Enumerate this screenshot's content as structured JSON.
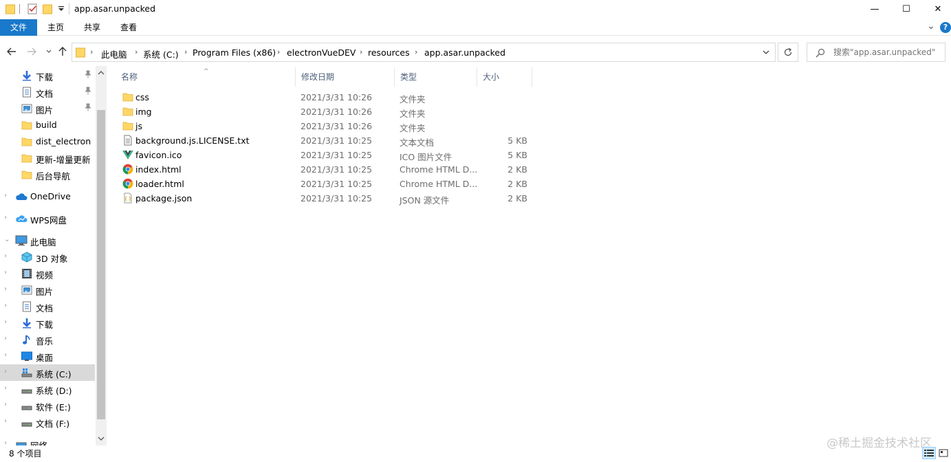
{
  "window": {
    "title": "app.asar.unpacked",
    "minimize": "—",
    "maximize": "☐",
    "close": "✕"
  },
  "ribbon": {
    "tabs": [
      "文件",
      "主页",
      "共享",
      "查看"
    ],
    "expand": "⌄",
    "help": "?"
  },
  "address": {
    "crumbs": [
      "此电脑",
      "系统 (C:)",
      "Program Files (x86)",
      "electronVueDEV",
      "resources",
      "app.asar.unpacked"
    ]
  },
  "search": {
    "placeholder": "搜索\"app.asar.unpacked\""
  },
  "nav": {
    "quick_access": [
      {
        "label": "下载",
        "icon": "download-arrow-icon",
        "pinned": true
      },
      {
        "label": "文档",
        "icon": "document-icon",
        "pinned": true
      },
      {
        "label": "图片",
        "icon": "pictures-icon",
        "pinned": true
      },
      {
        "label": "build",
        "icon": "folder-icon",
        "pinned": false
      },
      {
        "label": "dist_electron",
        "icon": "folder-icon",
        "pinned": false
      },
      {
        "label": "更新-增量更新",
        "icon": "folder-icon",
        "pinned": false
      },
      {
        "label": "后台导航",
        "icon": "folder-icon",
        "pinned": false
      }
    ],
    "onedrive": "OneDrive",
    "wps": "WPS网盘",
    "this_pc": "此电脑",
    "pc_items": [
      {
        "label": "3D 对象",
        "icon": "3d-objects-icon"
      },
      {
        "label": "视频",
        "icon": "video-icon"
      },
      {
        "label": "图片",
        "icon": "pictures-icon"
      },
      {
        "label": "文档",
        "icon": "document-icon"
      },
      {
        "label": "下载",
        "icon": "download-arrow-icon"
      },
      {
        "label": "音乐",
        "icon": "music-note-icon"
      },
      {
        "label": "桌面",
        "icon": "desktop-icon"
      },
      {
        "label": "系统 (C:)",
        "icon": "windows-drive-icon"
      },
      {
        "label": "系统 (D:)",
        "icon": "drive-icon"
      },
      {
        "label": "软件 (E:)",
        "icon": "drive-icon"
      },
      {
        "label": "文档 (F:)",
        "icon": "drive-icon"
      }
    ],
    "network": "网络"
  },
  "columns": [
    "名称",
    "修改日期",
    "类型",
    "大小"
  ],
  "files": [
    {
      "name": "css",
      "date": "2021/3/31 10:26",
      "type": "文件夹",
      "size": "",
      "icon": "folder-icon"
    },
    {
      "name": "img",
      "date": "2021/3/31 10:26",
      "type": "文件夹",
      "size": "",
      "icon": "folder-icon"
    },
    {
      "name": "js",
      "date": "2021/3/31 10:26",
      "type": "文件夹",
      "size": "",
      "icon": "folder-icon"
    },
    {
      "name": "background.js.LICENSE.txt",
      "date": "2021/3/31 10:25",
      "type": "文本文档",
      "size": "5 KB",
      "icon": "text-file-icon"
    },
    {
      "name": "favicon.ico",
      "date": "2021/3/31 10:25",
      "type": "ICO 图片文件",
      "size": "5 KB",
      "icon": "vue-logo-icon"
    },
    {
      "name": "index.html",
      "date": "2021/3/31 10:25",
      "type": "Chrome HTML D...",
      "size": "2 KB",
      "icon": "chrome-icon"
    },
    {
      "name": "loader.html",
      "date": "2021/3/31 10:25",
      "type": "Chrome HTML D...",
      "size": "2 KB",
      "icon": "chrome-icon"
    },
    {
      "name": "package.json",
      "date": "2021/3/31 10:25",
      "type": "JSON 源文件",
      "size": "2 KB",
      "icon": "json-file-icon"
    }
  ],
  "status": {
    "count": "8 个项目"
  },
  "watermark": "@稀土掘金技术社区"
}
